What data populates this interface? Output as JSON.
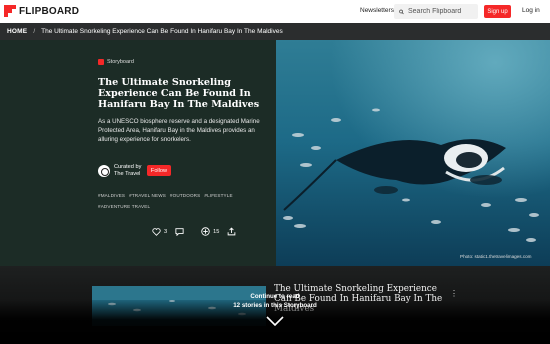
{
  "header": {
    "logo_text": "FLIPBOARD",
    "newsletters": "Newsletters",
    "search_placeholder": "Search Flipboard",
    "signup": "Sign up",
    "login": "Log in"
  },
  "breadcrumb": {
    "home": "HOME",
    "separator": "/",
    "current": "The Ultimate Snorkeling Experience Can Be Found In Hanifaru Bay In The Maldives"
  },
  "hero": {
    "badge": "Storyboard",
    "title": "The Ultimate Snorkeling Experience Can Be Found In Hanifaru Bay In The Maldives",
    "description": "As a UNESCO biosphere reserve and a designated Marine Protected Area, Hanifaru Bay in the Maldives provides an alluring experience for snorkelers.",
    "curated_by": "Curated by",
    "curator": "The Travel",
    "follow": "Follow",
    "tags": [
      "#MALDIVES",
      "#TRAVEL NEWS",
      "#OUTDOORS",
      "#LIFESTYLE",
      "#ADVENTURE TRAVEL"
    ],
    "likes": "3",
    "flips": "15",
    "photo_credit": "Photo: static1.thetravelimages.com"
  },
  "bottom": {
    "card_title": "The Ultimate Snorkeling Experience Can Be Found In Hanifaru Bay In The Maldives",
    "continue_line1": "Continue to read",
    "continue_line2": "12 stories in this Storyboard"
  },
  "colors": {
    "brand_red": "#f52828",
    "hero_panel": "#1c2c26",
    "breadcrumb_bg": "#2b2d2e"
  }
}
